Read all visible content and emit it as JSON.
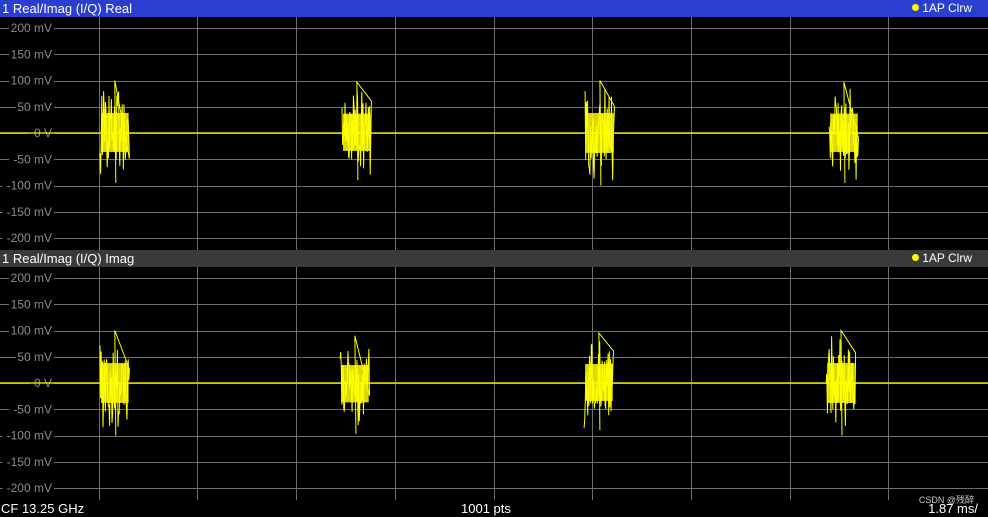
{
  "panels": [
    {
      "title": "1 Real/Imag (I/Q) Real",
      "trace_label": "1AP Clrw",
      "titlebar_color": "#2a3fd0"
    },
    {
      "title": "1 Real/Imag (I/Q) Imag",
      "trace_label": "1AP Clrw",
      "titlebar_color": "#3a3a3a"
    }
  ],
  "footer": {
    "center_frequency": "CF 13.25 GHz",
    "points": "1001 pts",
    "time_per_div": "1.87 ms/",
    "watermark": "CSDN @残醉"
  },
  "colors": {
    "trace": "#ffff00",
    "grid": "#6e6e6e",
    "tick_label": "#8c8c8c",
    "background": "#000000"
  },
  "chart_data": [
    {
      "type": "line",
      "title": "1 Real/Imag (I/Q) Real",
      "ylabel": "",
      "xlabel": "",
      "y_unit": "mV",
      "yticks": [
        "200 mV",
        "150 mV",
        "100 mV",
        "50 mV",
        "0 V",
        "-50 mV",
        "-100 mV",
        "-150 mV",
        "-200 mV"
      ],
      "ylim": [
        -200,
        200
      ],
      "x_divisions": 10,
      "time_per_div_ms": 1.87,
      "grid": true,
      "series": [
        {
          "baseline": 0,
          "bursts": [
            {
              "start_div": 0.02,
              "end_div": 0.32,
              "min": -95,
              "max": 100
            },
            {
              "start_div": 2.47,
              "end_div": 2.77,
              "min": -90,
              "max": 97
            },
            {
              "start_div": 4.93,
              "end_div": 5.23,
              "min": -100,
              "max": 100
            },
            {
              "start_div": 7.4,
              "end_div": 7.7,
              "min": -95,
              "max": 97
            }
          ]
        }
      ]
    },
    {
      "type": "line",
      "title": "1 Real/Imag (I/Q) Imag",
      "ylabel": "",
      "xlabel": "",
      "y_unit": "mV",
      "yticks": [
        "200 mV",
        "150 mV",
        "100 mV",
        "50 mV",
        "0 V",
        "-50 mV",
        "-100 mV",
        "-150 mV",
        "-200 mV"
      ],
      "ylim": [
        -200,
        200
      ],
      "x_divisions": 10,
      "time_per_div_ms": 1.87,
      "grid": true,
      "series": [
        {
          "baseline": 0,
          "bursts": [
            {
              "start_div": 0.02,
              "end_div": 0.32,
              "min": -100,
              "max": 100
            },
            {
              "start_div": 2.45,
              "end_div": 2.75,
              "min": -97,
              "max": 90
            },
            {
              "start_div": 4.92,
              "end_div": 5.22,
              "min": -90,
              "max": 95
            },
            {
              "start_div": 7.37,
              "end_div": 7.67,
              "min": -100,
              "max": 100
            }
          ]
        }
      ]
    }
  ]
}
